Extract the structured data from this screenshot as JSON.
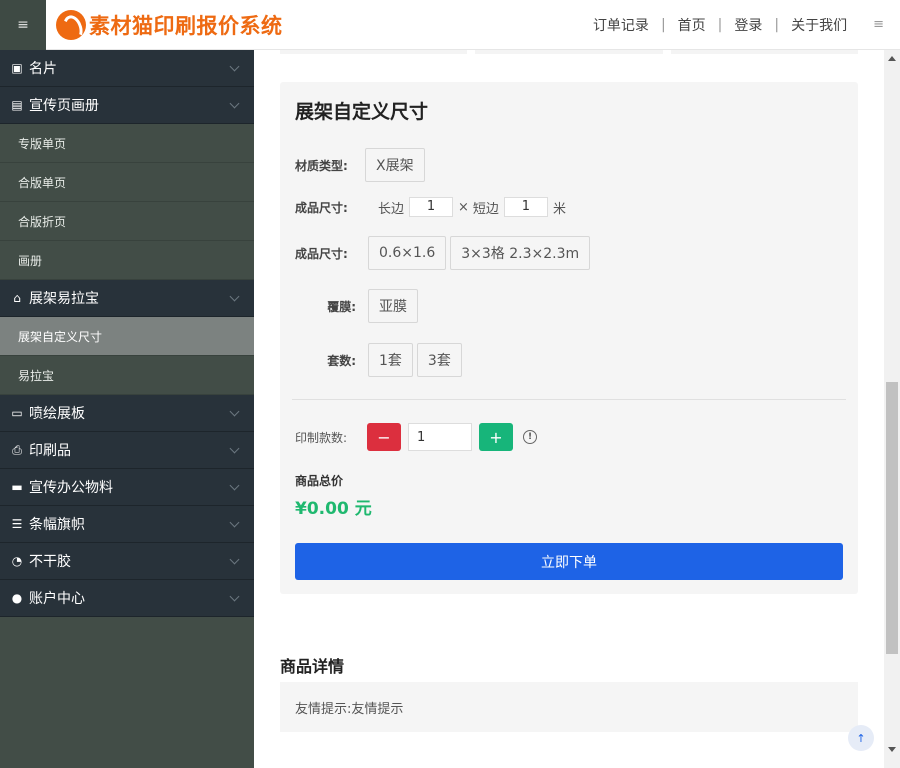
{
  "header": {
    "menu_icon": "hamburger-icon",
    "logo_text": "素材猫印刷报价系统",
    "nav": [
      "订单记录",
      "首页",
      "登录",
      "关于我们"
    ],
    "separator": "|",
    "more_icon": "≡"
  },
  "sidebar": {
    "groups": [
      {
        "icon": "card-icon",
        "glyph": "▣",
        "label": "名片"
      },
      {
        "icon": "flyer-icon",
        "glyph": "▤",
        "label": "宣传页画册"
      },
      {
        "icon": "stand-icon",
        "glyph": "⌂",
        "label": "展架易拉宝"
      },
      {
        "icon": "board-icon",
        "glyph": "▭",
        "label": "喷绘展板"
      },
      {
        "icon": "printer-icon",
        "glyph": "⎙",
        "label": "印刷品"
      },
      {
        "icon": "briefcase-icon",
        "glyph": "▬",
        "label": "宣传办公物料"
      },
      {
        "icon": "banner-icon",
        "glyph": "☰",
        "label": "条幅旗帜"
      },
      {
        "icon": "sticker-icon",
        "glyph": "◔",
        "label": "不干胶"
      },
      {
        "icon": "user-icon",
        "glyph": "●",
        "label": "账户中心"
      }
    ],
    "flyer_subs": [
      "专版单页",
      "合版单页",
      "合版折页",
      "画册"
    ],
    "stand_subs": [
      "展架自定义尺寸",
      "易拉宝"
    ]
  },
  "panel": {
    "title": "展架自定义尺寸",
    "material_label": "材质类型:",
    "material_options": [
      "X展架"
    ],
    "size_label": "成品尺寸:",
    "long_label": "长边",
    "long_value": "1",
    "times": "×",
    "short_label": "短边",
    "short_value": "1",
    "unit": "米",
    "size2_label": "成品尺寸:",
    "size_options": [
      "0.6×1.6",
      "3×3格 2.3×2.3m"
    ],
    "film_label": "覆膜:",
    "film_options": [
      "亚膜"
    ],
    "sets_label": "套数:",
    "sets_options": [
      "1套",
      "3套"
    ],
    "qty_label": "印制款数:",
    "qty_value": "1",
    "minus": "−",
    "plus": "+",
    "info_glyph": "!",
    "total_label": "商品总价",
    "total_value": "¥0.00 元",
    "order_button": "立即下单"
  },
  "details": {
    "title": "商品详情",
    "tip": "友情提示:友情提示"
  },
  "to_top_glyph": "↑"
}
